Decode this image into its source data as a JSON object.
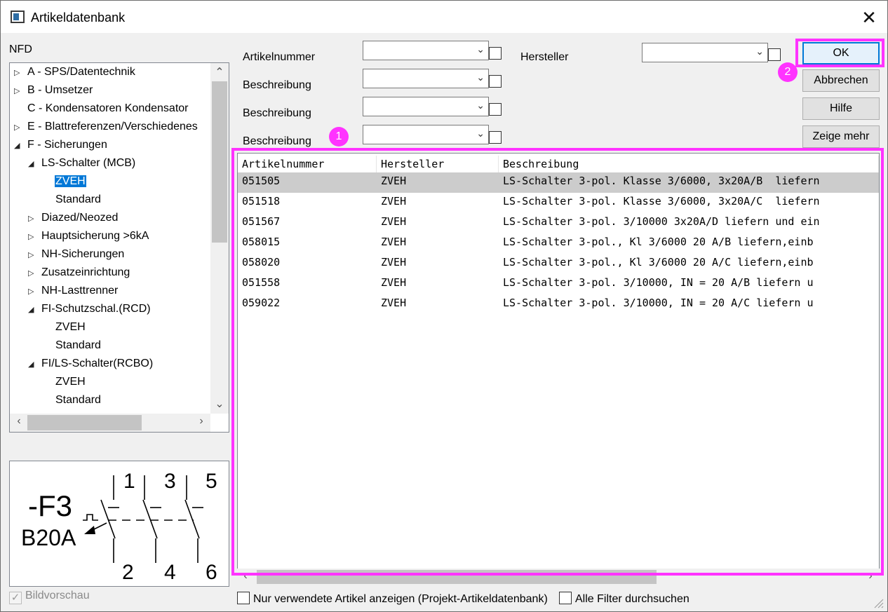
{
  "window": {
    "title": "Artikeldatenbank",
    "close_glyph": "✕"
  },
  "tree": {
    "label": "NFD",
    "items": [
      {
        "label": "A - SPS/Datentechnik",
        "level": 0,
        "state": "collapsed"
      },
      {
        "label": "B - Umsetzer",
        "level": 0,
        "state": "collapsed"
      },
      {
        "label": "C - Kondensatoren Kondensator",
        "level": 0,
        "state": "leaf"
      },
      {
        "label": "E - Blattreferenzen/Verschiedenes",
        "level": 0,
        "state": "collapsed"
      },
      {
        "label": "F - Sicherungen",
        "level": 0,
        "state": "expanded"
      },
      {
        "label": "LS-Schalter (MCB)",
        "level": 1,
        "state": "expanded"
      },
      {
        "label": "ZVEH",
        "level": 2,
        "state": "leaf",
        "selected": true
      },
      {
        "label": "Standard",
        "level": 2,
        "state": "leaf"
      },
      {
        "label": "Diazed/Neozed",
        "level": 1,
        "state": "collapsed"
      },
      {
        "label": "Hauptsicherung >6kA",
        "level": 1,
        "state": "collapsed"
      },
      {
        "label": "NH-Sicherungen",
        "level": 1,
        "state": "collapsed"
      },
      {
        "label": "Zusatzeinrichtung",
        "level": 1,
        "state": "collapsed"
      },
      {
        "label": "NH-Lasttrenner",
        "level": 1,
        "state": "collapsed"
      },
      {
        "label": "FI-Schutzschal.(RCD)",
        "level": 1,
        "state": "expanded"
      },
      {
        "label": "ZVEH",
        "level": 2,
        "state": "leaf"
      },
      {
        "label": "Standard",
        "level": 2,
        "state": "leaf"
      },
      {
        "label": "FI/LS-Schalter(RCBO)",
        "level": 1,
        "state": "expanded"
      },
      {
        "label": "ZVEH",
        "level": 2,
        "state": "leaf"
      },
      {
        "label": "Standard",
        "level": 2,
        "state": "leaf"
      }
    ]
  },
  "preview": {
    "designation": "-F3",
    "rating": "B20A",
    "terminals_top": [
      "1",
      "3",
      "5"
    ],
    "terminals_bottom": [
      "2",
      "4",
      "6"
    ],
    "checkbox_label": "Bildvorschau",
    "checked": true
  },
  "filters": {
    "artikelnummer_label": "Artikelnummer",
    "beschreibung_label_1": "Beschreibung",
    "beschreibung_label_2": "Beschreibung",
    "beschreibung_label_3": "Beschreibung",
    "hersteller_label": "Hersteller"
  },
  "buttons": {
    "ok": "OK",
    "abbrechen": "Abbrechen",
    "hilfe": "Hilfe",
    "zeige_mehr": "Zeige mehr"
  },
  "grid": {
    "columns": [
      "Artikelnummer",
      "Hersteller",
      "Beschreibung"
    ],
    "rows": [
      [
        "051505",
        "ZVEH",
        "LS-Schalter 3-pol. Klasse 3/6000, 3x20A/B  liefern"
      ],
      [
        "051518",
        "ZVEH",
        "LS-Schalter 3-pol. Klasse 3/6000, 3x20A/C  liefern"
      ],
      [
        "051567",
        "ZVEH",
        "LS-Schalter 3-pol. 3/10000 3x20A/D liefern und ein"
      ],
      [
        "058015",
        "ZVEH",
        "LS-Schalter 3-pol., Kl 3/6000 20 A/B liefern,einb"
      ],
      [
        "058020",
        "ZVEH",
        "LS-Schalter 3-pol., Kl 3/6000 20 A/C liefern,einb"
      ],
      [
        "051558",
        "ZVEH",
        "LS-Schalter 3-pol. 3/10000, IN = 20 A/B liefern u"
      ],
      [
        "059022",
        "ZVEH",
        "LS-Schalter 3-pol. 3/10000, IN = 20 A/C liefern u"
      ]
    ],
    "selected_row": 0
  },
  "bottom": {
    "nur_verwendete": "Nur verwendete Artikel anzeigen (Projekt-Artikeldatenbank)",
    "alle_filter": "Alle Filter durchsuchen"
  },
  "annotations": {
    "badge_1": "1",
    "badge_2": "2",
    "color": "#ff33ff"
  }
}
